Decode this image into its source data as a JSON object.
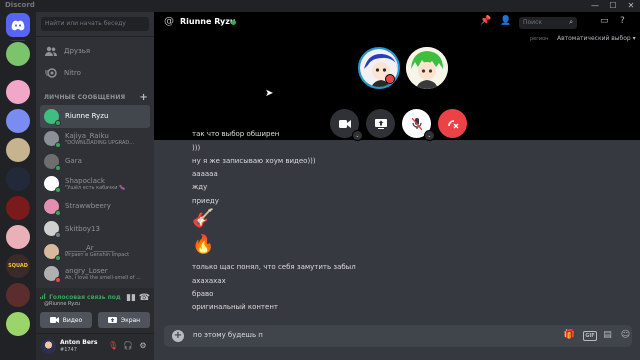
{
  "app": {
    "title": "Discord"
  },
  "window_controls": [
    "—",
    "☐",
    "✕"
  ],
  "servers": [
    {
      "name": "home",
      "label": "",
      "color": "#5865f2"
    },
    {
      "name": "server-1",
      "label": "",
      "color": "#7cc46b"
    },
    {
      "name": "server-2",
      "label": "",
      "color": "#f2a7c9"
    },
    {
      "name": "server-3",
      "label": "",
      "color": "#7a8cf2"
    },
    {
      "name": "server-4",
      "label": "",
      "color": "#c6b48f"
    },
    {
      "name": "server-5",
      "label": "",
      "color": "#222a3a"
    },
    {
      "name": "server-6",
      "label": "",
      "color": "#7a1a1a"
    },
    {
      "name": "server-7",
      "label": "",
      "color": "#e9b0b8"
    },
    {
      "name": "server-8",
      "label": "SQUAD",
      "color": "#3a2a2a"
    },
    {
      "name": "server-9",
      "label": "",
      "color": "#5b2d2d"
    },
    {
      "name": "server-10",
      "label": "",
      "color": "#9bd46b"
    },
    {
      "name": "server-11",
      "label": "RL",
      "color": "#d9d9d9"
    },
    {
      "name": "server-12",
      "label": "",
      "color": "#8a4fd6"
    },
    {
      "name": "server-13",
      "label": "",
      "color": "#6b2bbf"
    }
  ],
  "dm": {
    "search_placeholder": "Найти или начать беседу",
    "friends": "Друзья",
    "nitro": "Nitro",
    "header": "ЛИЧНЫЕ СООБЩЕНИЯ",
    "items": [
      {
        "name": "Riunne Ryzu",
        "sub": "",
        "status": "online",
        "avatar": "#3fbf7f",
        "active": true
      },
      {
        "name": "Kajiya_Raiku",
        "sub": "\"DOWNLOADING UPGRAD...",
        "status": "online",
        "avatar": "#8a8f98",
        "active": false
      },
      {
        "name": "Gara",
        "sub": "",
        "status": "online",
        "avatar": "#6e6e6e",
        "active": false
      },
      {
        "name": "Shapoclack",
        "sub": "\"Ушёл есть кабачки 🍆",
        "status": "online",
        "avatar": "#ffffff",
        "active": false
      },
      {
        "name": "Strawwbeery",
        "sub": "",
        "status": "online",
        "avatar": "#e58fb0",
        "active": false
      },
      {
        "name": "Skitboy13",
        "sub": "",
        "status": "idle",
        "avatar": "#d0d0d0",
        "active": false
      },
      {
        "name": "______Ar______",
        "sub": "Играет в Genshin Impact",
        "status": "online",
        "avatar": "#d9b8a0",
        "active": false
      },
      {
        "name": "angry_Loser",
        "sub": "Ah, i love the smell-smell of ...",
        "status": "dnd",
        "avatar": "#b0b0b0",
        "active": false
      }
    ]
  },
  "voice": {
    "status": "Голосовая связь под",
    "location": "@Riunne Ryzu",
    "video": "Видео",
    "screen": "Экран"
  },
  "user": {
    "name": "Anton Bers",
    "tag": "#1747"
  },
  "topbar": {
    "title": "Riunne Ryzu",
    "search_placeholder": "Поиск"
  },
  "call": {
    "region_label": "регион",
    "region_value": "Автоматический выбор"
  },
  "messages": [
    {
      "type": "text",
      "text": "так что выбор обширен"
    },
    {
      "type": "text",
      "text": ")))"
    },
    {
      "type": "text",
      "text": "ну я же записываю хоум видео)))"
    },
    {
      "type": "text",
      "text": "аааааа"
    },
    {
      "type": "text",
      "text": "жду"
    },
    {
      "type": "text",
      "text": "приеду"
    },
    {
      "type": "emoji",
      "text": "🎸"
    },
    {
      "type": "emoji",
      "text": "🔥"
    },
    {
      "type": "text",
      "text": "только щас понял, что себя замутить забыл"
    },
    {
      "type": "text",
      "text": "ахахахах"
    },
    {
      "type": "text",
      "text": "браво"
    },
    {
      "type": "text",
      "text": "оригинальный контент"
    }
  ],
  "composer": {
    "value": "по этому будешь п"
  },
  "colors": {
    "accent": "#5865f2",
    "online": "#3ba55d",
    "danger": "#ed4245",
    "idle": "#747f8d"
  }
}
